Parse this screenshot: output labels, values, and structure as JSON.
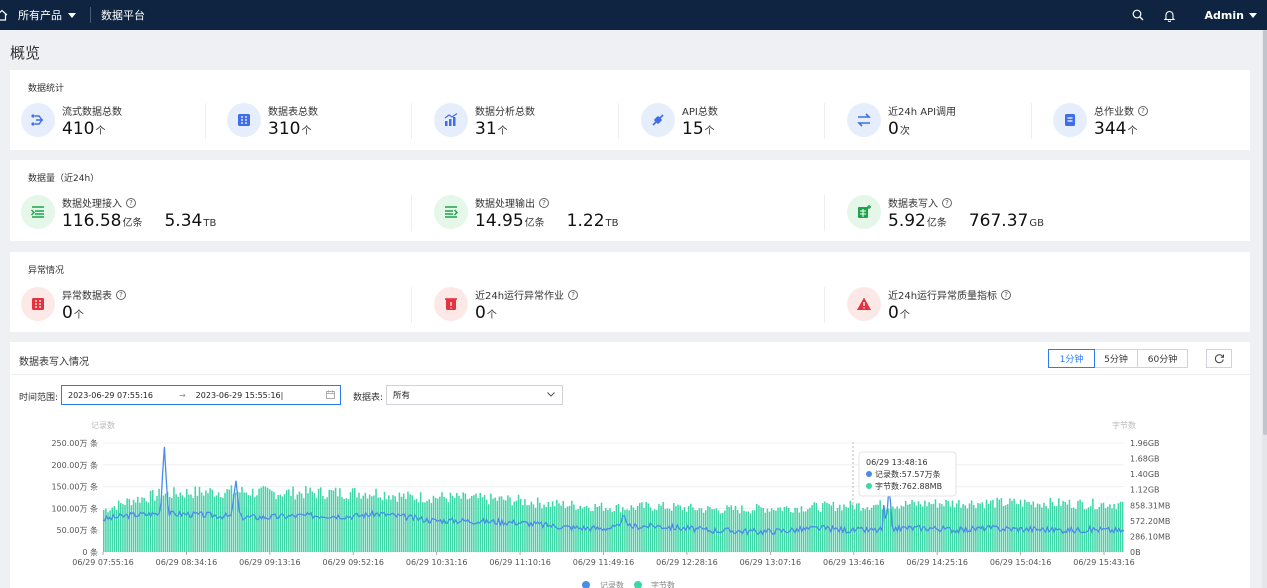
{
  "topbar": {
    "all_products": "所有产品",
    "platform": "数据平台",
    "user": "Admin"
  },
  "page_title": "概览",
  "data_stats": {
    "title": "数据统计",
    "items": [
      {
        "label": "流式数据总数",
        "value": "410",
        "unit": "个",
        "icon": "stream-icon"
      },
      {
        "label": "数据表总数",
        "value": "310",
        "unit": "个",
        "icon": "table-icon"
      },
      {
        "label": "数据分析总数",
        "value": "31",
        "unit": "个",
        "icon": "analysis-icon"
      },
      {
        "label": "API总数",
        "value": "15",
        "unit": "个",
        "icon": "api-icon"
      },
      {
        "label": "近24h API调用",
        "value": "0",
        "unit": "次",
        "icon": "api-call-icon"
      },
      {
        "label": "总作业数",
        "value": "344",
        "unit": "个",
        "icon": "job-icon"
      }
    ]
  },
  "volume": {
    "title": "数据量（近24h）",
    "items": [
      {
        "label": "数据处理接入",
        "v1": "116.58",
        "u1": "亿条",
        "v2": "5.34",
        "u2": "TB"
      },
      {
        "label": "数据处理输出",
        "v1": "14.95",
        "u1": "亿条",
        "v2": "1.22",
        "u2": "TB"
      },
      {
        "label": "数据表写入",
        "v1": "5.92",
        "u1": "亿条",
        "v2": "767.37",
        "u2": "GB"
      }
    ]
  },
  "anomaly": {
    "title": "异常情况",
    "items": [
      {
        "label": "异常数据表",
        "value": "0",
        "unit": "个"
      },
      {
        "label": "近24h运行异常作业",
        "value": "0",
        "unit": "个"
      },
      {
        "label": "近24h运行异常质量指标",
        "value": "0",
        "unit": "个"
      }
    ]
  },
  "chart_panel": {
    "title": "数据表写入情况",
    "intervals": [
      "1分钟",
      "5分钟",
      "60分钟"
    ],
    "active_interval": "1分钟",
    "time_range_label": "时间范围:",
    "start": "2023-06-29 07:55:16",
    "end": "2023-06-29 15:55:16",
    "table_label": "数据表:",
    "table_value": "所有"
  },
  "tooltip": {
    "time": "06/29 13:48:16",
    "records": "记录数:57.57万条",
    "bytes": "字节数:762.88MB"
  },
  "colors": {
    "records": "#4a90e2",
    "bytes": "#3ed6a6",
    "accent": "#2d7bf4",
    "topbar": "#0f2440"
  },
  "chart_data": {
    "type": "bar+line",
    "x": [
      "06/29 07:55:16",
      "06/29 08:34:16",
      "06/29 09:13:16",
      "06/29 09:52:16",
      "06/29 10:31:16",
      "06/29 11:10:16",
      "06/29 11:49:16",
      "06/29 12:28:16",
      "06/29 13:07:16",
      "06/29 13:46:16",
      "06/29 14:25:16",
      "06/29 15:04:16",
      "06/29 15:43:16"
    ],
    "left_axis_name": "记录数",
    "right_axis_name": "字节数",
    "y_left_ticks": [
      "0 条",
      "50.00万 条",
      "100.00万 条",
      "150.00万 条",
      "200.00万 条",
      "250.00万 条"
    ],
    "y_right_ticks": [
      "0B",
      "286.10MB",
      "572.20MB",
      "858.31MB",
      "1.12GB",
      "1.40GB",
      "1.68GB",
      "1.96GB"
    ],
    "ylim_left": [
      0,
      250
    ],
    "ylim_right_gb": [
      0,
      1.96
    ],
    "series": [
      {
        "name": "记录数",
        "type": "line",
        "unit": "万条",
        "values": [
          75,
          85,
          88,
          87,
          84,
          80,
          80,
          83,
          84,
          82,
          88,
          80,
          72,
          72,
          70,
          68,
          62,
          56,
          54,
          58,
          60,
          55,
          50,
          48,
          47,
          50,
          55,
          50,
          50,
          55,
          55,
          50,
          55,
          53,
          52,
          50,
          52,
          48
        ]
      },
      {
        "name": "字节数",
        "type": "bar",
        "unit": "GB",
        "values": [
          0.78,
          0.96,
          1.06,
          1.1,
          1.12,
          1.12,
          1.1,
          1.1,
          1.1,
          1.1,
          1.1,
          1.02,
          1.02,
          1.0,
          0.98,
          0.96,
          0.9,
          0.87,
          0.84,
          0.82,
          0.85,
          0.82,
          0.79,
          0.79,
          0.81,
          0.82,
          0.84,
          0.86,
          0.87,
          0.88,
          0.9,
          0.91,
          0.91,
          0.91,
          0.91,
          0.9,
          0.89,
          0.89
        ]
      }
    ],
    "peaks": [
      {
        "x": "06/29 08:34:16",
        "records": 245
      },
      {
        "x": "06/29 09:04:16",
        "records": 170
      },
      {
        "x": "06/29 13:50:16",
        "records": 160
      }
    ],
    "legend": "bottom-center",
    "grid": true
  }
}
